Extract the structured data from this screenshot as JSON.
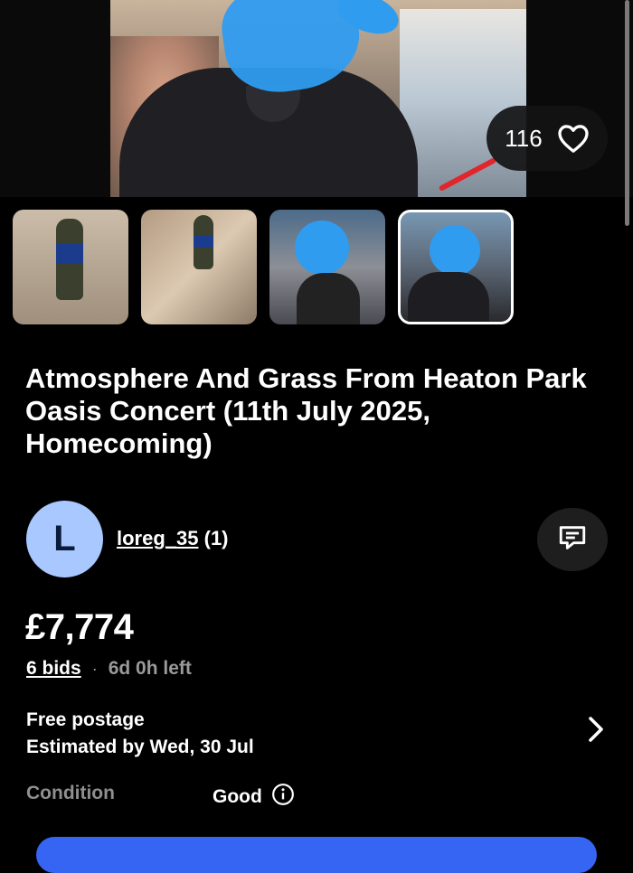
{
  "gallery": {
    "like_count": "116",
    "thumbnail_count": 4,
    "selected_index": 3
  },
  "listing": {
    "title": "Atmosphere And Grass From Heaton Park Oasis Concert (11th July 2025, Homecoming)"
  },
  "seller": {
    "avatar_letter": "L",
    "name": "loreg_35",
    "feedback": "(1)"
  },
  "pricing": {
    "price": "£7,774",
    "bids": "6 bids",
    "separator": "·",
    "time_left": "6d 0h left"
  },
  "shipping": {
    "line1": "Free postage",
    "line2": "Estimated by Wed, 30 Jul"
  },
  "condition": {
    "label": "Condition",
    "value": "Good"
  },
  "icons": {
    "heart": "heart-icon",
    "message": "message-icon",
    "chevron": "chevron-right-icon",
    "info": "info-icon"
  },
  "colors": {
    "background": "#000000",
    "avatar": "#a8c8ff",
    "accent_button": "#3665f3",
    "muted_text": "#8f8f8f"
  }
}
